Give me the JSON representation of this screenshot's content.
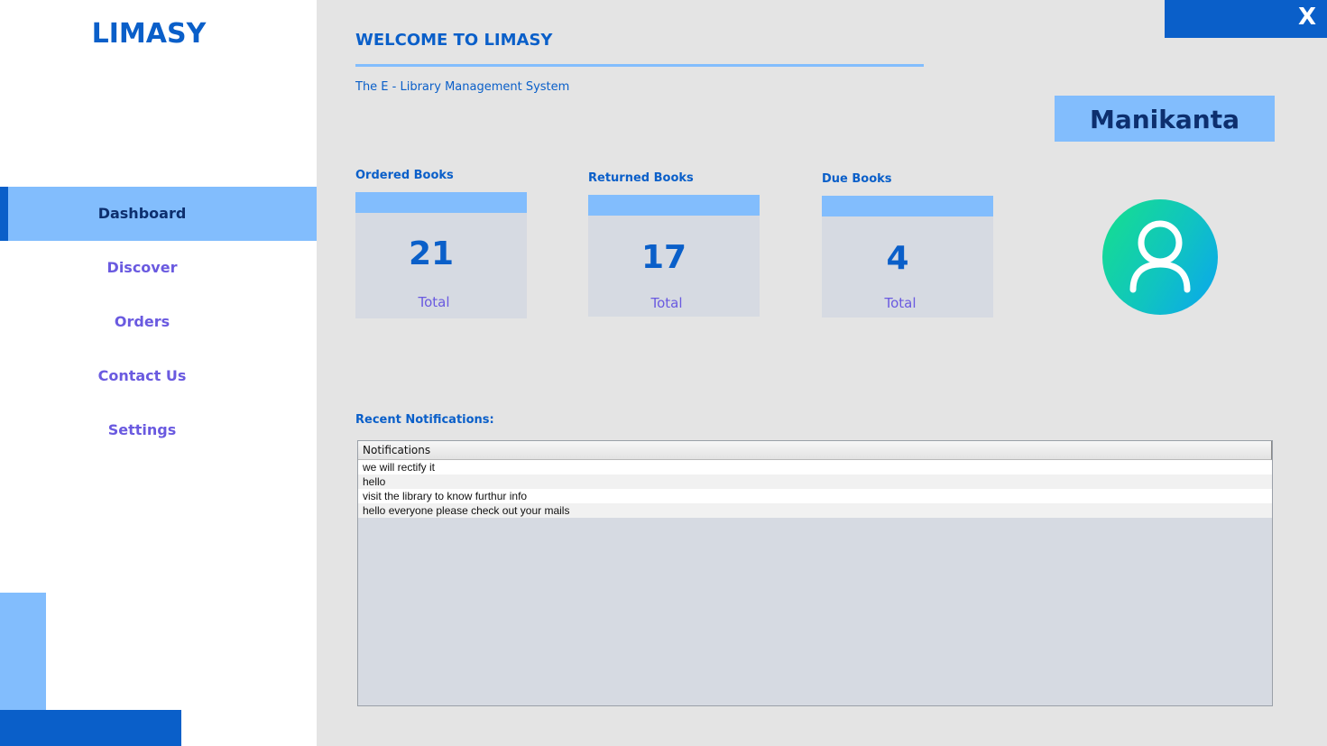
{
  "brand": "LIMASY",
  "header": {
    "welcome": "WELCOME TO LIMASY",
    "subtitle": "The E - Library Management System",
    "close_label": "X"
  },
  "user": {
    "name": "Manikanta",
    "avatar_icon": "user-icon"
  },
  "sidebar": {
    "items": [
      {
        "label": "Dashboard",
        "active": true
      },
      {
        "label": "Discover"
      },
      {
        "label": "Orders"
      },
      {
        "label": "Contact Us"
      },
      {
        "label": "Settings"
      }
    ]
  },
  "stats": [
    {
      "title": "Ordered Books",
      "value": "21",
      "caption": "Total"
    },
    {
      "title": "Returned Books",
      "value": "17",
      "caption": "Total"
    },
    {
      "title": "Due Books",
      "value": "4",
      "caption": "Total"
    }
  ],
  "notifications": {
    "label": "Recent Notifications:",
    "column": "Notifications",
    "rows": [
      "we will rectify it",
      "hello",
      "visit the library to know furthur info",
      "hello everyone please check out your mails"
    ]
  },
  "colors": {
    "primary": "#0a5fc9",
    "accent_light": "#82bdfd",
    "nav_text": "#6a5ae0",
    "background": "#e4e4e4"
  }
}
